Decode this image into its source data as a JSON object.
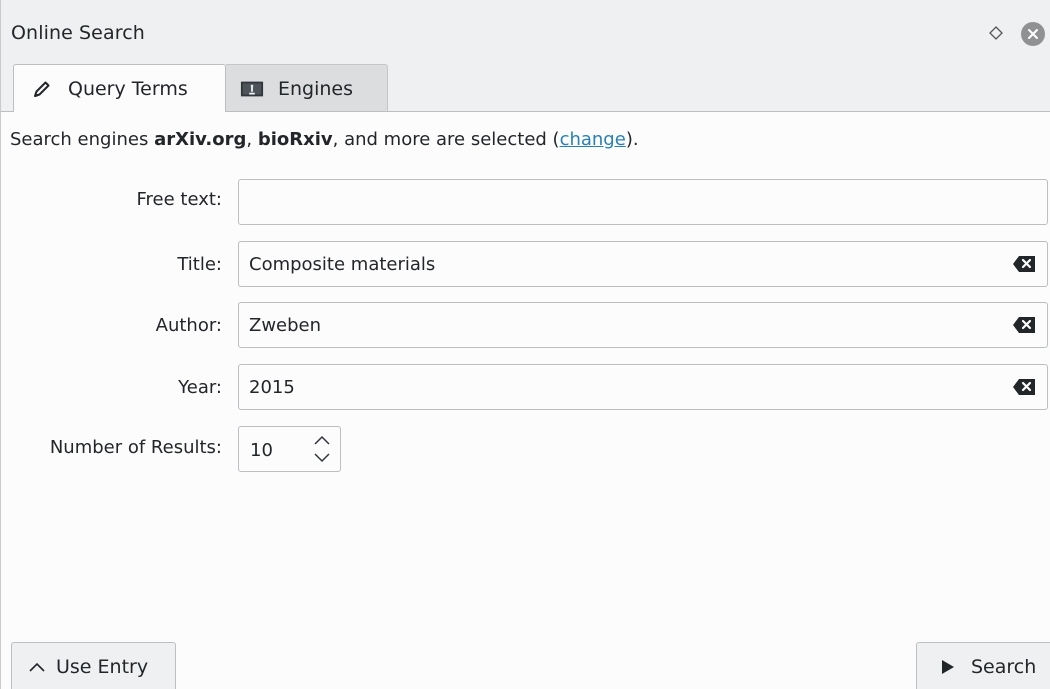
{
  "window": {
    "title": "Online Search",
    "float_icon": "diamond-icon",
    "close_icon": "close-icon"
  },
  "tabs": [
    {
      "label": "Query Terms",
      "icon": "pencil-icon",
      "active": true
    },
    {
      "label": "Engines",
      "icon": "engines-icon",
      "active": false
    }
  ],
  "engines_info": {
    "prefix": "Search engines ",
    "engine1": "arXiv.org",
    "sep1": ", ",
    "engine2": "bioRxiv",
    "middle": ", and more are selected (",
    "change_link": "change",
    "suffix": ")."
  },
  "form": {
    "free_text": {
      "label": "Free text:",
      "value": ""
    },
    "title": {
      "label": "Title:",
      "value": "Composite materials"
    },
    "author": {
      "label": "Author:",
      "value": "Zweben"
    },
    "year": {
      "label": "Year:",
      "value": "2015"
    },
    "num_results": {
      "label": "Number of Results:",
      "value": "10"
    }
  },
  "buttons": {
    "use_entry": "Use Entry",
    "search": "Search"
  },
  "colors": {
    "link": "#2980b9",
    "window_bg": "#eff0f1",
    "panel_bg": "#fcfcfc"
  }
}
